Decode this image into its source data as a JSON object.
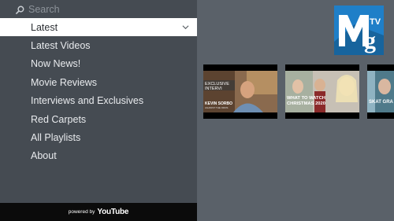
{
  "search": {
    "placeholder": "Search",
    "icon": "search-icon"
  },
  "nav": {
    "items": [
      {
        "label": "Latest",
        "active": true
      },
      {
        "label": "Latest Videos"
      },
      {
        "label": "Now News!"
      },
      {
        "label": "Movie Reviews"
      },
      {
        "label": "Interviews and Exclusives"
      },
      {
        "label": "Red Carpets"
      },
      {
        "label": "All Playlists"
      },
      {
        "label": "About"
      }
    ]
  },
  "footer": {
    "powered_by": "powered by",
    "brand": "YouTube"
  },
  "logo": {
    "text": "MTVg"
  },
  "thumbnails": [
    {
      "title_line1": "EXCLUSIVE",
      "title_line2": "INTERVI",
      "caption": "KEVIN SORBO",
      "subcaption": "AGAINST THE ODDS"
    },
    {
      "title_line1": "WHAT TO WATCH",
      "title_line2": "CHRISTMAS 2020"
    },
    {
      "title_line1": "SKAT GRA"
    }
  ],
  "colors": {
    "background": "#5a6169",
    "sidebar": "#454b52",
    "logo_blue": "#1f7fc8"
  }
}
